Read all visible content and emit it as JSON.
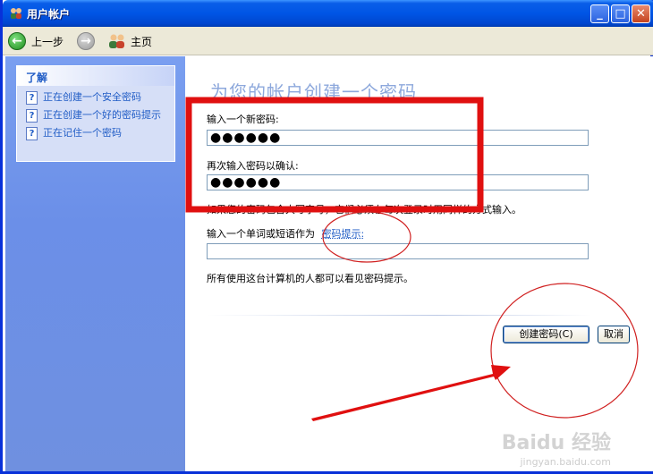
{
  "window": {
    "title": "用户帐户"
  },
  "toolbar": {
    "back_label": "上一步",
    "home_label": "主页"
  },
  "sidebar": {
    "header": "了解",
    "items": [
      {
        "label": "正在创建一个安全密码"
      },
      {
        "label": "正在创建一个好的密码提示"
      },
      {
        "label": "正在记住一个密码"
      }
    ]
  },
  "main": {
    "title": "为您的帐户创建一个密码",
    "new_password_label": "输入一个新密码:",
    "new_password_value": "●●●●●●",
    "confirm_label": "再次输入密码以确认:",
    "confirm_value": "●●●●●●",
    "case_note": "如果您的密码包含大写字母，它们必须在每次登录时用同样的方式输入。",
    "hint_label_prefix": "输入一个单词或短语作为",
    "hint_link": "密码提示:",
    "hint_value": "",
    "visibility_note": "所有使用这台计算机的人都可以看见密码提示。",
    "create_button": "创建密码(C)",
    "cancel_button": "取消"
  },
  "watermark": {
    "brand": "Baidu 经验",
    "url": "jingyan.baidu.com"
  },
  "colors": {
    "titlebar": "#0055e5",
    "sidebar": "#6b8fe8",
    "annotation": "#e01010",
    "link": "#215dc6"
  }
}
